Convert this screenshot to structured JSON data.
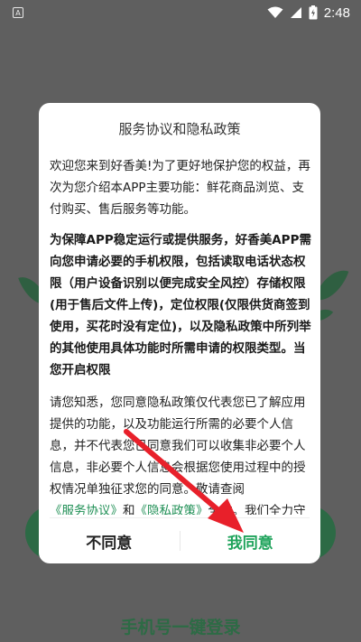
{
  "status_bar": {
    "notification_glyph": "A",
    "time": "2:48"
  },
  "background": {
    "login_button_label": "手机号一键登录"
  },
  "dialog": {
    "title": "服务协议和隐私政策",
    "para1": "欢迎您来到好香美!为了更好地保护您的权益，再次为您介绍本APP主要功能：鲜花商品浏览、支付购买、售后服务等功能。",
    "para2": "为保障APP稳定运行或提供服务，好香美APP需向您申请必要的手机权限，包括读取电话状态权限（用户设备识别以便完成安全风控）存储权限(用于售后文件上传)，定位权限(仅限供货商签到使用，买花时没有定位)，以及隐私政策中所列举的其他使用具体功能时所需申请的权限类型。当您开启权限",
    "para3_a": "请您知悉，您同意隐私政策仅代表您已了解应用提供的功能，以及功能运行所需的必要个人信息，并不代表您已同意我们可以收集非必要个人信息，非必要个人信息会根据您使用过程中的授权情况单独征求您的同意。敬请查阅",
    "link_service": "《服务协议》",
    "para3_b": "和",
    "link_privacy": "《隐私政策》",
    "para3_c": "全文。我们全力守护您的信息安全!",
    "decline_label": "不同意",
    "agree_label": "我同意"
  },
  "colors": {
    "accent_green": "#1fa35b",
    "link_green": "#1f8f55",
    "arrow_red": "#e8202a",
    "overlay": "#5f5f5f"
  }
}
